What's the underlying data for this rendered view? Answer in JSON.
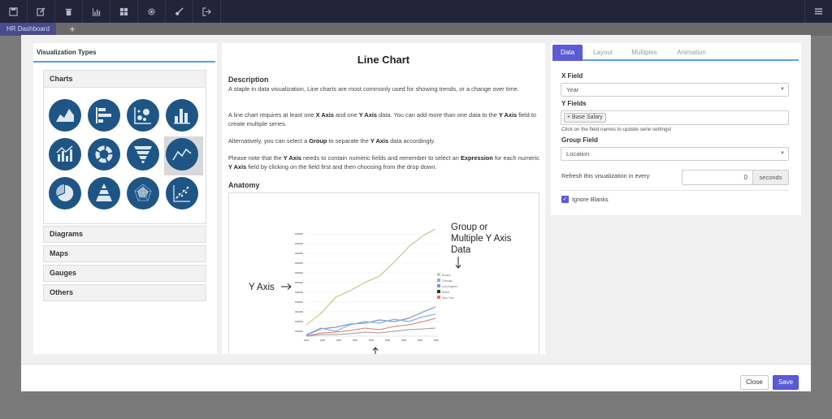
{
  "toolbar": {
    "icons": [
      "save-icon",
      "edit-icon",
      "trash-icon",
      "bar-chart-icon",
      "grid-icon",
      "gear-icon",
      "brush-icon",
      "exit-icon"
    ],
    "right_icon": "menu-icon"
  },
  "tabs_bar": {
    "active_tab": "HR Dashboard",
    "add_label": "+"
  },
  "left_panel": {
    "title": "Visualization Types",
    "sections": [
      "Charts",
      "Diagrams",
      "Maps",
      "Gauges",
      "Others"
    ],
    "chart_icons": [
      "area-chart-icon",
      "horizontal-bar-chart-icon",
      "bubble-chart-icon",
      "column-chart-icon",
      "mixed-chart-icon",
      "donut-chart-icon",
      "funnel-chart-icon",
      "line-chart-icon",
      "pie-chart-icon",
      "pyramid-chart-icon",
      "radar-chart-icon",
      "scatter-chart-icon"
    ],
    "selected_icon": "line-chart-icon",
    "icon_color": "#1f5585"
  },
  "middle_panel": {
    "title": "Line Chart",
    "description_heading": "Description",
    "p1": "A staple in data visualization, Line charts are most commonly used for showing trends, or a change over time.",
    "p2": {
      "t1": "A line chart requires at least one ",
      "b1": "X Axis",
      "t2": " and one ",
      "b2": "Y Axis",
      "t3": " data. You can add more than one data to the ",
      "b3": "Y Axis",
      "t4": " field to create multiple series."
    },
    "p3": {
      "t1": "Alternatively, you can select a ",
      "b1": "Group",
      "t2": " to separate the ",
      "b2": "Y Axis",
      "t3": " data accordingly."
    },
    "p4": {
      "t1": "Please note that the ",
      "b1": "Y Axis",
      "t2": " needs to contain numeric fields and remember to select an ",
      "b2": "Expression",
      "t3": " for each numeric ",
      "b3": "Y Axis",
      "t4": " field by clicking on the field first and then choosing from the drop down."
    },
    "anatomy_heading": "Anatomy",
    "anatomy": {
      "y_axis_label": "Y Axis",
      "group_label_line1": "Group or",
      "group_label_line2": "Multiple Y Axis",
      "group_label_line3": "Data",
      "legend": [
        {
          "name": "Boston",
          "color": "#c5d29b"
        },
        {
          "name": "Chicago",
          "color": "#7fb6e6"
        },
        {
          "name": "Los Angeles",
          "color": "#8a8fd0"
        },
        {
          "name": "Miami",
          "color": "#333333"
        },
        {
          "name": "New York",
          "color": "#e07a6a"
        }
      ]
    }
  },
  "right_panel": {
    "tabs": [
      "Data",
      "Layout",
      "Multiples",
      "Animation"
    ],
    "active_tab": "Data",
    "x_field_label": "X Field",
    "x_field_value": "Year",
    "y_fields_label": "Y Fields",
    "y_fields_chip": "Base Salary",
    "y_fields_chip_remove": "×",
    "y_fields_hint": "Click on the field names to update serie settings!",
    "group_field_label": "Group Field",
    "group_field_value": "Location",
    "refresh_label": "Refresh this visualization in every",
    "refresh_value": "0",
    "refresh_unit": "seconds",
    "ignore_blanks_label": "Ignore Blanks",
    "ignore_blanks_checked": true,
    "accent_color": "#5b5bd6"
  },
  "footer": {
    "close_label": "Close",
    "save_label": "Save"
  }
}
